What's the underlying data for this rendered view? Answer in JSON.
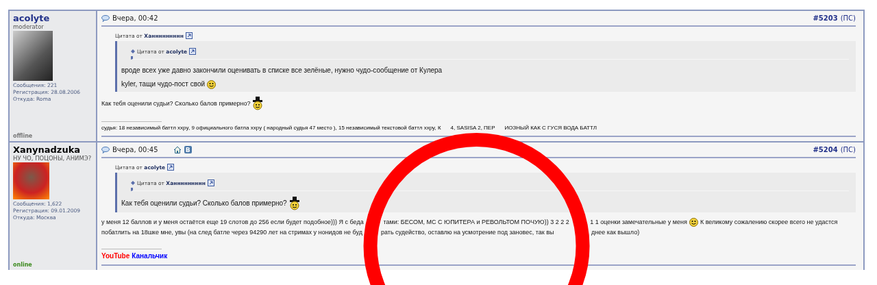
{
  "posts": [
    {
      "author": "acolyte",
      "role": "moderator",
      "color": "#22318a",
      "stats": [
        "Сообщения: 221",
        "Регистрация: 28.08.2006",
        "Откуда: Roma"
      ],
      "status": "offline",
      "online": false,
      "time": "Вчера, 00:42",
      "number": "#5203",
      "suffix": "(ПС)",
      "quote": {
        "label": "Цитата от",
        "author": "Ханнннннннн",
        "nested": {
          "label": "Цитата от",
          "author": "acolyte"
        },
        "lines": [
          [
            {
              "kind": "text",
              "text": "вроде всех уже давно закончили оценивать в списке все зелёные, нужно чудо-сообщение от Кулера"
            }
          ],
          [
            {
              "kind": "text",
              "text": "kyler, тащи чудо-пост свой"
            },
            {
              "kind": "smiley"
            }
          ]
        ]
      },
      "body": [
        [
          {
            "kind": "text",
            "text": "Как тебя оценили судьи? Сколько балов примерно?"
          },
          {
            "kind": "hat_smiley"
          }
        ]
      ],
      "signature": [
        {
          "kind": "text",
          "text": "судья: 18 независимый баттл xxpy, 9 официального батла xxpy ( народный судья 47 место ), 15 независимый текстовой баттл xxpy, К"
        },
        {
          "kind": "gap"
        },
        {
          "kind": "text",
          "text": "4, SASISA 2, ПЕР"
        },
        {
          "kind": "gap"
        },
        {
          "kind": "text",
          "text": "ИОЗНЫЙ КАК С ГУСЯ ВОДА БАТТЛ"
        }
      ]
    },
    {
      "author": "Xanynadzuka",
      "role": "НУ ЧО, ПОЦОНЫ, АНИМЭ?",
      "color": "#000000",
      "stats": [
        "Сообщения: 1,622",
        "Регистрация: 09.01.2009",
        "Откуда: Москва"
      ],
      "status": "online",
      "online": true,
      "time": "Вчера, 00:45",
      "badges": [
        {
          "kind": "home"
        },
        {
          "kind": "vk",
          "text": "B"
        }
      ],
      "number": "#5204",
      "suffix": "(ПС)",
      "quote": {
        "label": "Цитата от",
        "author": "acolyte",
        "nested": {
          "label": "Цитата от",
          "author": "Ханнннннннн"
        },
        "lines": [
          [
            {
              "kind": "text",
              "text": "Как тебя оценили судьи? Сколько балов примерно?"
            },
            {
              "kind": "hat_smiley"
            }
          ]
        ]
      },
      "body": [
        [
          {
            "kind": "text",
            "text": "у меня 12 баллов и у меня остаётся еще 19 слотов до 256 если будет подобное))) Я с беда"
          },
          {
            "kind": "gap"
          },
          {
            "kind": "text",
            "text": "тами: БЕСОМ, МС С ЮПИТЕРА и РЕВОЛЬТОМ ПОЧУЮ)) 3 2 2 2"
          },
          {
            "kind": "gap"
          },
          {
            "kind": "text",
            "text": "1 1 оценки замечательные у меня"
          },
          {
            "kind": "smiley"
          },
          {
            "kind": "text",
            "text": "К великому сожалению скорее всего не удастся"
          }
        ],
        [
          {
            "kind": "text",
            "text": "побатлить на 18шке мне, увы (на след батле через 94290 лет на стримах у нонидов не буд"
          },
          {
            "kind": "gap"
          },
          {
            "kind": "text",
            "text": "рать судейство, оставлю на усмотрение под занoвес, так вы"
          },
          {
            "kind": "gap"
          },
          {
            "kind": "text",
            "text": "днее как вышло)"
          }
        ]
      ],
      "signature": [
        {
          "kind": "text",
          "text": "YouTube",
          "color": "#ff0000"
        },
        {
          "kind": "text",
          "text": "Канальчик",
          "color": "#0000ff"
        }
      ]
    }
  ]
}
